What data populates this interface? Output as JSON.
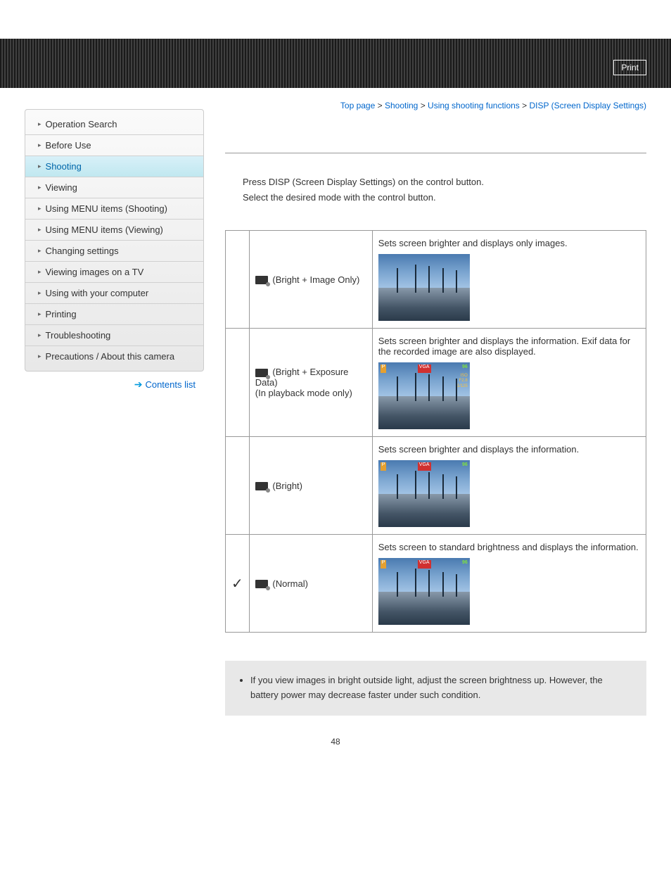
{
  "header": {
    "print": "Print"
  },
  "breadcrumb": {
    "items": [
      "Top page",
      "Shooting",
      "Using shooting functions",
      "DISP (Screen Display Settings)"
    ]
  },
  "sidebar": {
    "items": [
      {
        "label": "Operation Search"
      },
      {
        "label": "Before Use"
      },
      {
        "label": "Shooting"
      },
      {
        "label": "Viewing"
      },
      {
        "label": "Using MENU items (Shooting)"
      },
      {
        "label": "Using MENU items (Viewing)"
      },
      {
        "label": "Changing settings"
      },
      {
        "label": "Viewing images on a TV"
      },
      {
        "label": "Using with your computer"
      },
      {
        "label": "Printing"
      },
      {
        "label": "Troubleshooting"
      },
      {
        "label": "Precautions / About this camera"
      }
    ],
    "contents_list": "Contents list"
  },
  "intro": {
    "line1": "Press DISP (Screen Display Settings) on the control button.",
    "line2": "Select the desired mode with the control button."
  },
  "modes": [
    {
      "label": "(Bright + Image Only)",
      "sub": "",
      "desc": "Sets screen brighter and displays only images.",
      "overlay": false,
      "exif": false,
      "checked": false
    },
    {
      "label": "(Bright + Exposure Data)",
      "sub": "(In playback mode only)",
      "desc": "Sets screen brighter and displays the information. Exif data for the recorded image are also displayed.",
      "overlay": true,
      "exif": true,
      "checked": false
    },
    {
      "label": "(Bright)",
      "sub": "",
      "desc": "Sets screen brighter and displays the information.",
      "overlay": true,
      "exif": false,
      "checked": false
    },
    {
      "label": "(Normal)",
      "sub": "",
      "desc": "Sets screen to standard brightness and displays the information.",
      "overlay": true,
      "exif": false,
      "checked": true
    }
  ],
  "overlay_text": {
    "left": "P",
    "mid": "VGA",
    "right": "96"
  },
  "note": "If you view images in bright outside light, adjust the screen brightness up. However, the battery power may decrease faster under such condition.",
  "page_number": "48"
}
